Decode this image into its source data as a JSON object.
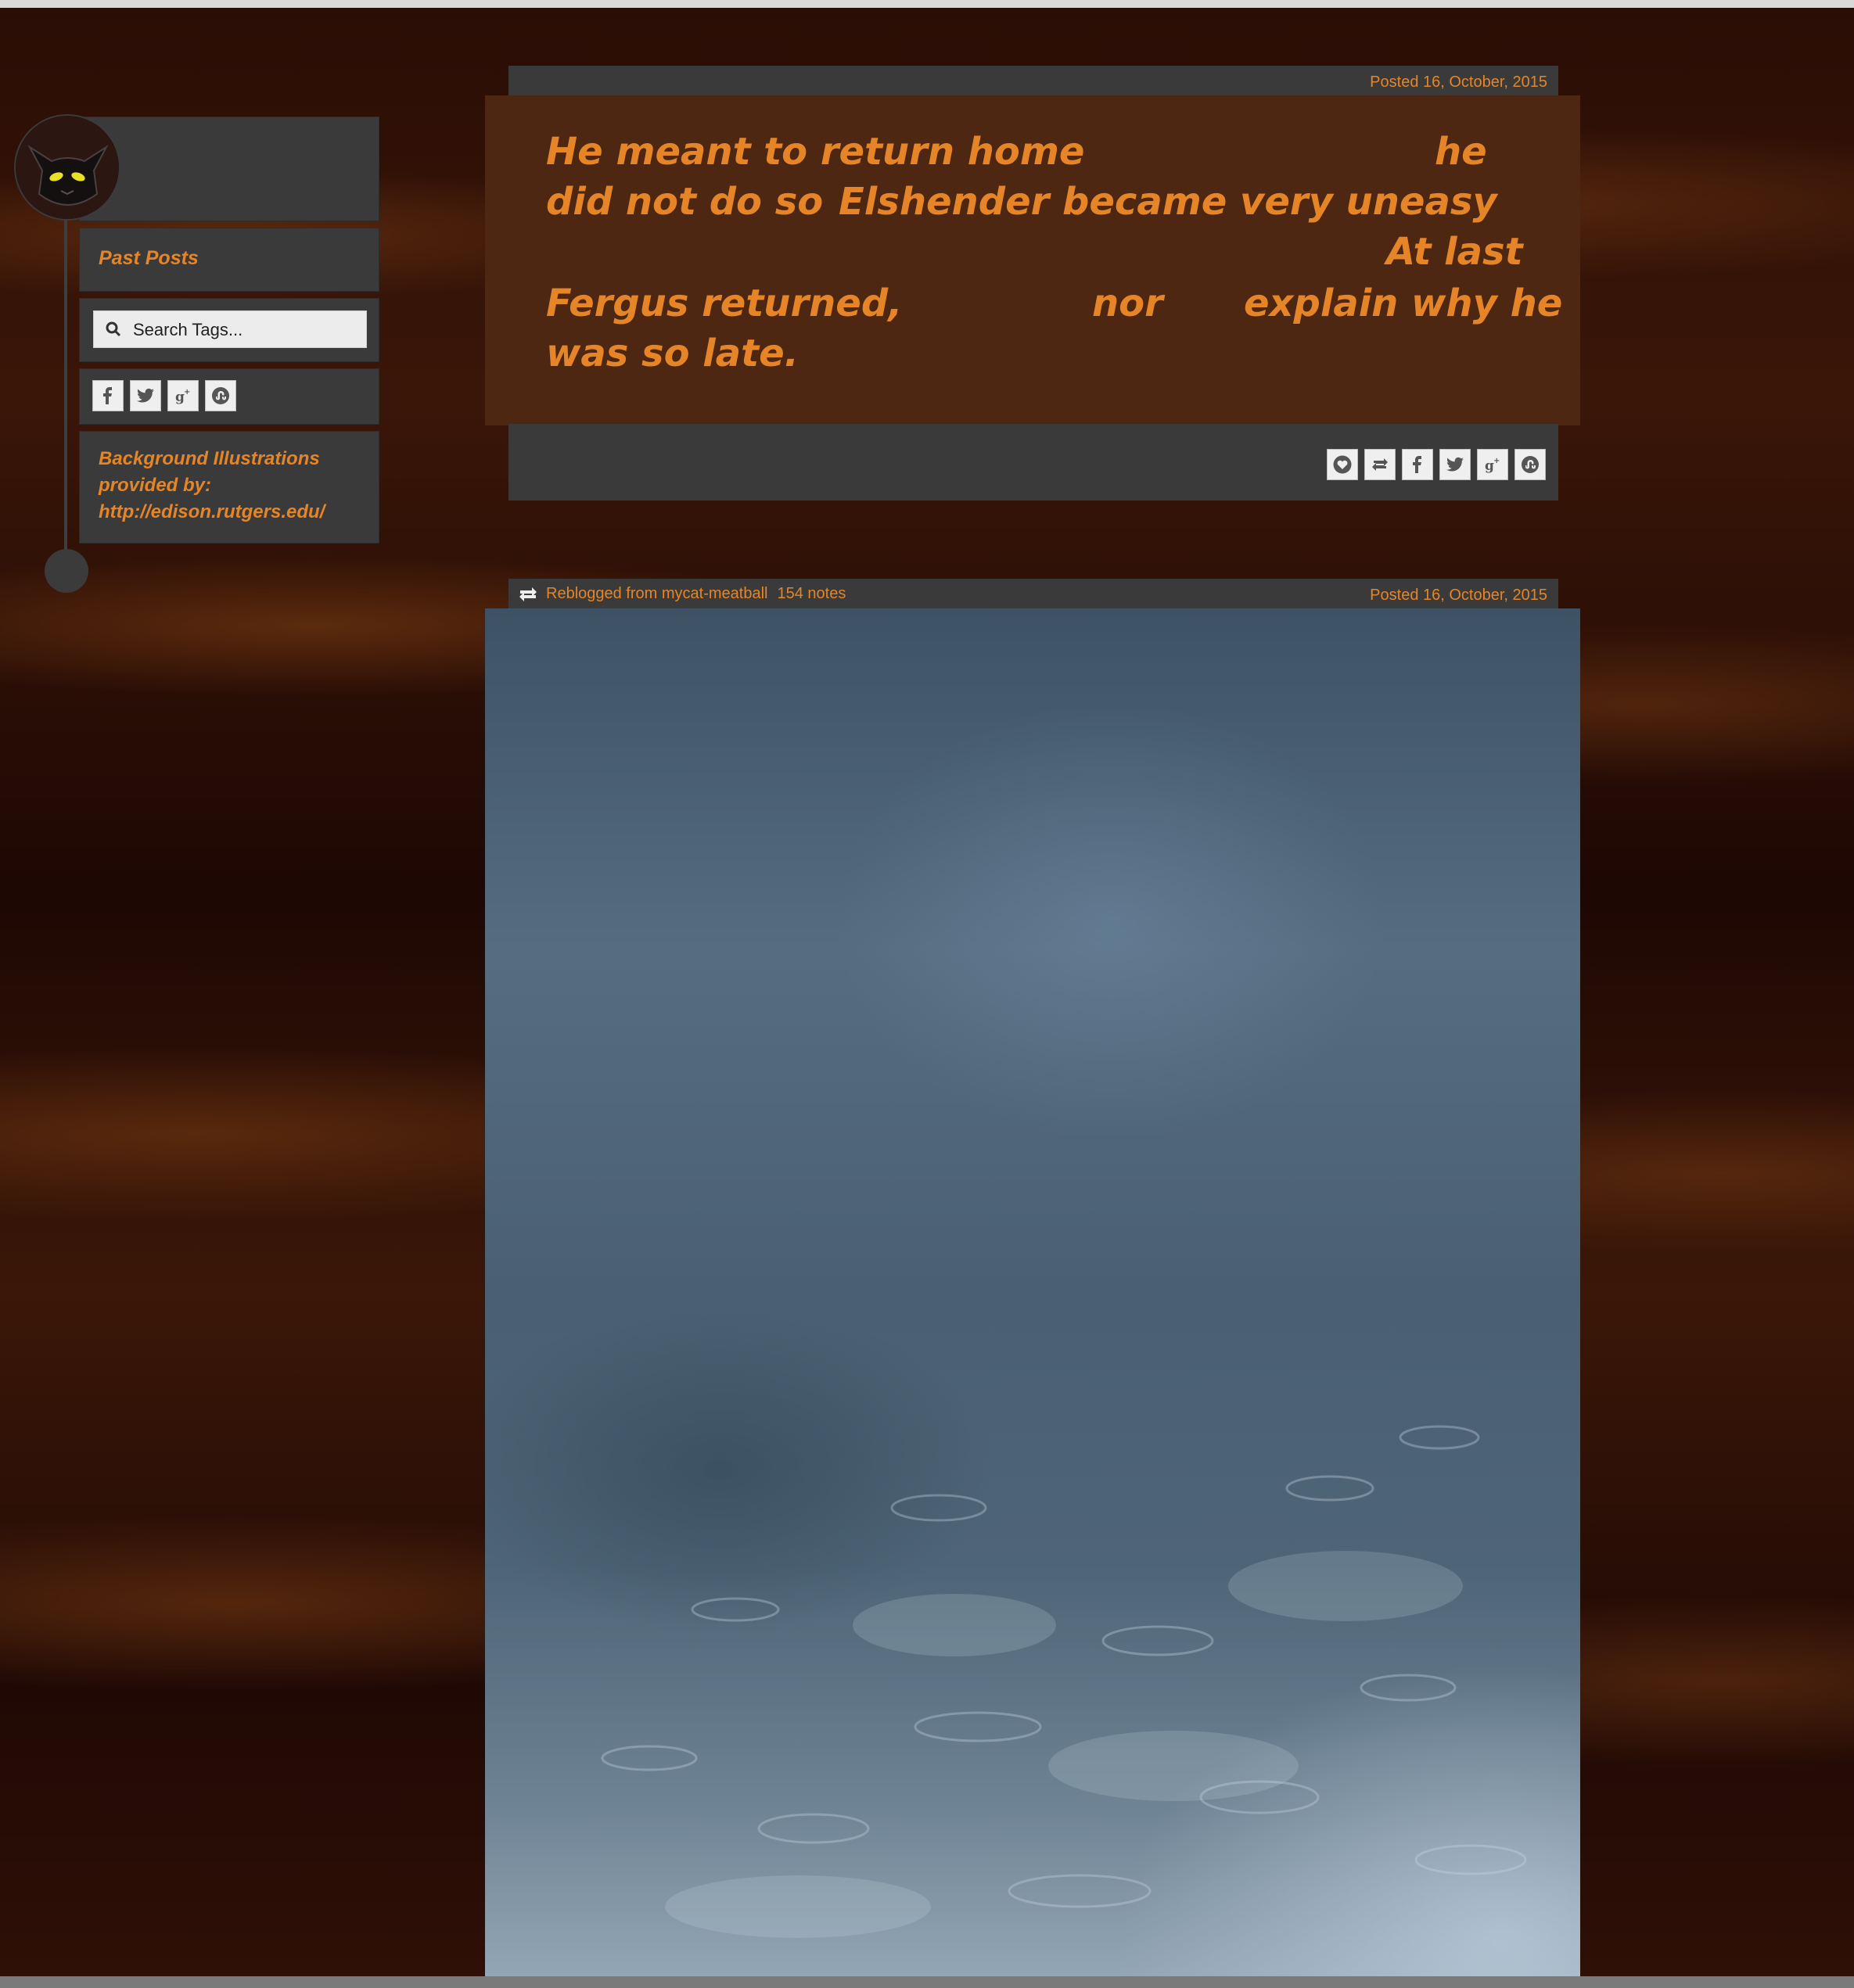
{
  "sidebar": {
    "past_posts_label": "Past Posts",
    "search_placeholder": "Search Tags...",
    "social_icons": [
      "facebook-icon",
      "twitter-icon",
      "google-plus-icon",
      "stumbleupon-icon"
    ],
    "credits": {
      "line1": "Background Illustrations",
      "line2": "provided by:",
      "line3": "http://edison.rutgers.edu/"
    }
  },
  "post1": {
    "posted": "Posted 16, October, 2015",
    "quote": {
      "l1a": "He meant to return home",
      "l1b": "he",
      "l2a": "did not do so",
      "l2b": "Elshender became very uneasy",
      "l3": "At last",
      "l4a": "Fergus returned,",
      "l4b": "nor",
      "l4c": "explain why he",
      "l5": "was so late."
    },
    "actions": [
      "heart-icon",
      "reblog-icon",
      "facebook-icon",
      "twitter-icon",
      "google-plus-icon",
      "stumbleupon-icon"
    ]
  },
  "post2": {
    "reblogged_from": "Reblogged from mycat-meatball",
    "notes": "154 notes",
    "posted": "Posted 16, October, 2015"
  },
  "colors": {
    "accent": "#e58527",
    "panel": "#3a3a3a",
    "quote_bg": "#4d2711"
  }
}
